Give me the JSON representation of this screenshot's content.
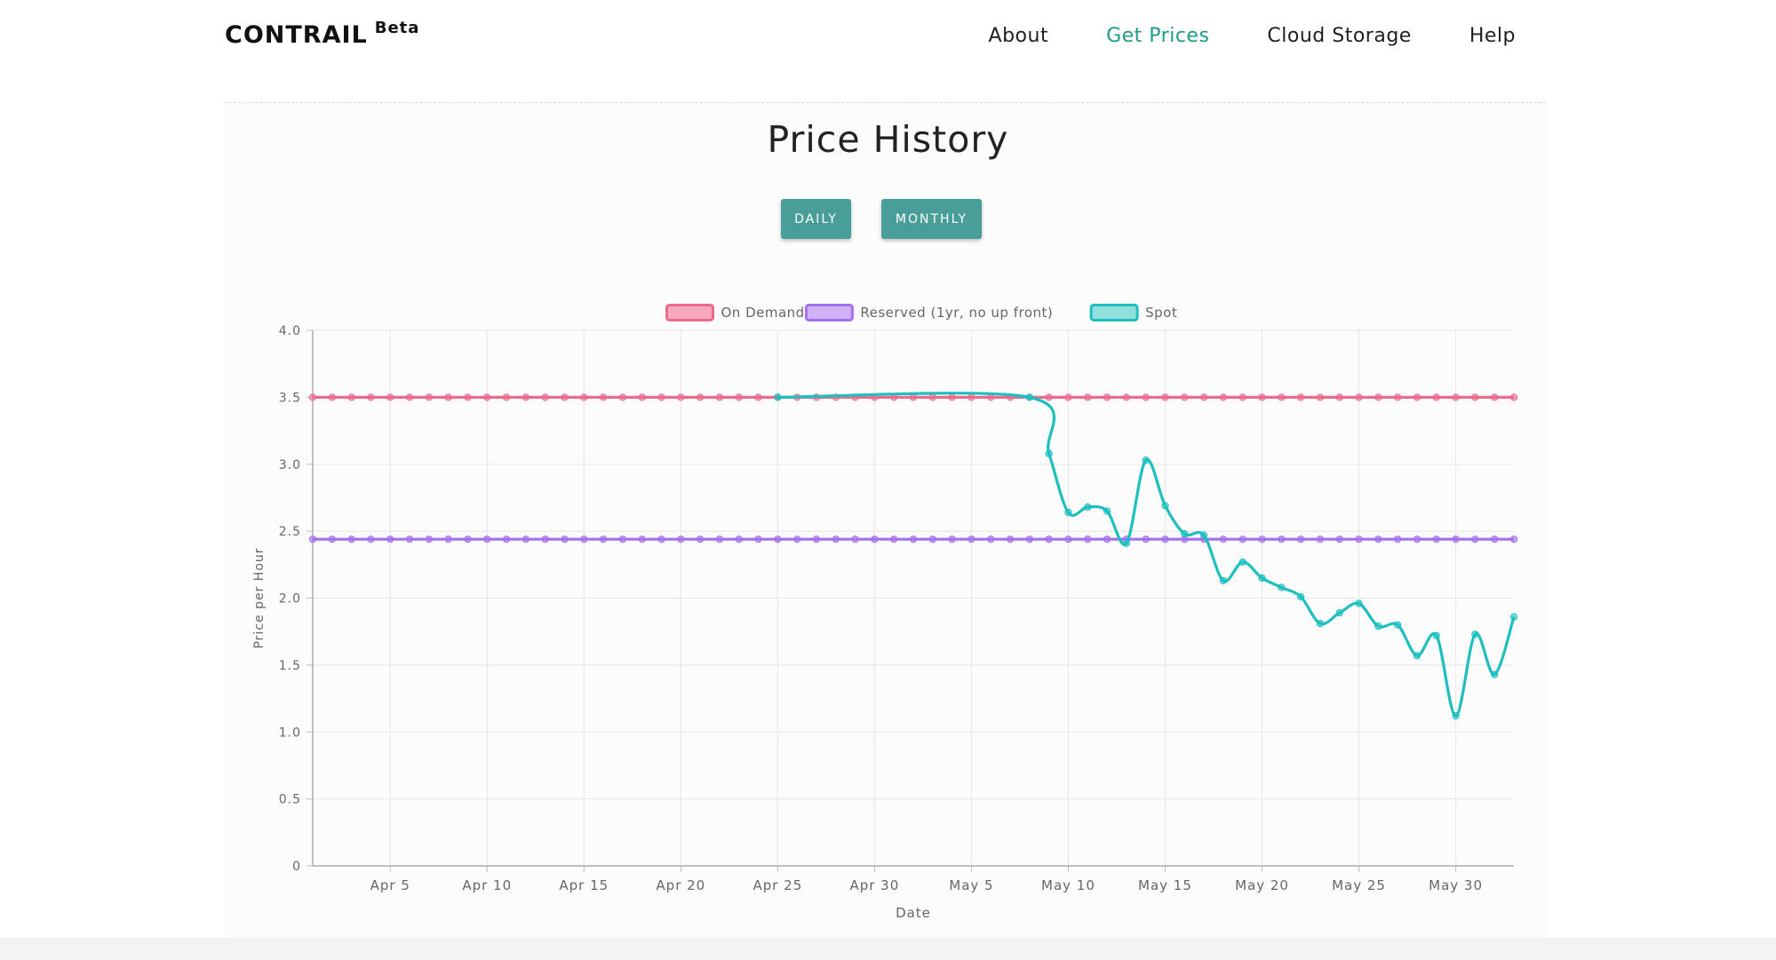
{
  "nav": {
    "brand": "CONTRAIL",
    "brand_sup": "Beta",
    "links": [
      "About",
      "Get Prices",
      "Cloud Storage",
      "Help"
    ]
  },
  "page": {
    "title": "Price History",
    "buttons": [
      "DAILY",
      "MONTHLY"
    ]
  },
  "colors": {
    "accent": "#1f9b89",
    "button": "#4a9e9a",
    "on_demand": "#ec6b8c",
    "reserved": "#a56ff0",
    "spot": "#1dbfbf"
  },
  "chart_data": {
    "type": "line",
    "xlabel": "Date",
    "ylabel": "Price per Hour",
    "ylim": [
      0,
      4.0
    ],
    "yticks": [
      "4.0",
      "3.5",
      "3.0",
      "2.5",
      "2.0",
      "1.5",
      "1.0",
      "0.5",
      "0"
    ],
    "x_start": "Apr 1",
    "x_end": "Jun 2",
    "xticks": [
      "Apr 5",
      "Apr 10",
      "Apr 15",
      "Apr 20",
      "Apr 25",
      "Apr 30",
      "May 5",
      "May 10",
      "May 15",
      "May 20",
      "May 25",
      "May 30"
    ],
    "grid": true,
    "legend_position": "top",
    "series": [
      {
        "name": "On Demand",
        "x": [
          "Apr 1",
          "Apr 2",
          "Apr 3",
          "Apr 4",
          "Apr 5",
          "Apr 6",
          "Apr 7",
          "Apr 8",
          "Apr 9",
          "Apr 10",
          "Apr 11",
          "Apr 12",
          "Apr 13",
          "Apr 14",
          "Apr 15",
          "Apr 16",
          "Apr 17",
          "Apr 18",
          "Apr 19",
          "Apr 20",
          "Apr 21",
          "Apr 22",
          "Apr 23",
          "Apr 24",
          "Apr 25",
          "Apr 26",
          "Apr 27",
          "Apr 28",
          "Apr 29",
          "Apr 30",
          "May 1",
          "May 2",
          "May 3",
          "May 4",
          "May 5",
          "May 6",
          "May 7",
          "May 8",
          "May 9",
          "May 10",
          "May 11",
          "May 12",
          "May 13",
          "May 14",
          "May 15",
          "May 16",
          "May 17",
          "May 18",
          "May 19",
          "May 20",
          "May 21",
          "May 22",
          "May 23",
          "May 24",
          "May 25",
          "May 26",
          "May 27",
          "May 28",
          "May 29",
          "May 30",
          "May 31",
          "Jun 1",
          "Jun 2"
        ],
        "values": [
          3.5,
          3.5,
          3.5,
          3.5,
          3.5,
          3.5,
          3.5,
          3.5,
          3.5,
          3.5,
          3.5,
          3.5,
          3.5,
          3.5,
          3.5,
          3.5,
          3.5,
          3.5,
          3.5,
          3.5,
          3.5,
          3.5,
          3.5,
          3.5,
          3.5,
          3.5,
          3.5,
          3.5,
          3.5,
          3.5,
          3.5,
          3.5,
          3.5,
          3.5,
          3.5,
          3.5,
          3.5,
          3.5,
          3.5,
          3.5,
          3.5,
          3.5,
          3.5,
          3.5,
          3.5,
          3.5,
          3.5,
          3.5,
          3.5,
          3.5,
          3.5,
          3.5,
          3.5,
          3.5,
          3.5,
          3.5,
          3.5,
          3.5,
          3.5,
          3.5,
          3.5,
          3.5,
          3.5
        ]
      },
      {
        "name": "Reserved (1yr, no up front)",
        "x": [
          "Apr 1",
          "Apr 2",
          "Apr 3",
          "Apr 4",
          "Apr 5",
          "Apr 6",
          "Apr 7",
          "Apr 8",
          "Apr 9",
          "Apr 10",
          "Apr 11",
          "Apr 12",
          "Apr 13",
          "Apr 14",
          "Apr 15",
          "Apr 16",
          "Apr 17",
          "Apr 18",
          "Apr 19",
          "Apr 20",
          "Apr 21",
          "Apr 22",
          "Apr 23",
          "Apr 24",
          "Apr 25",
          "Apr 26",
          "Apr 27",
          "Apr 28",
          "Apr 29",
          "Apr 30",
          "May 1",
          "May 2",
          "May 3",
          "May 4",
          "May 5",
          "May 6",
          "May 7",
          "May 8",
          "May 9",
          "May 10",
          "May 11",
          "May 12",
          "May 13",
          "May 14",
          "May 15",
          "May 16",
          "May 17",
          "May 18",
          "May 19",
          "May 20",
          "May 21",
          "May 22",
          "May 23",
          "May 24",
          "May 25",
          "May 26",
          "May 27",
          "May 28",
          "May 29",
          "May 30",
          "May 31",
          "Jun 1",
          "Jun 2"
        ],
        "values": [
          2.44,
          2.44,
          2.44,
          2.44,
          2.44,
          2.44,
          2.44,
          2.44,
          2.44,
          2.44,
          2.44,
          2.44,
          2.44,
          2.44,
          2.44,
          2.44,
          2.44,
          2.44,
          2.44,
          2.44,
          2.44,
          2.44,
          2.44,
          2.44,
          2.44,
          2.44,
          2.44,
          2.44,
          2.44,
          2.44,
          2.44,
          2.44,
          2.44,
          2.44,
          2.44,
          2.44,
          2.44,
          2.44,
          2.44,
          2.44,
          2.44,
          2.44,
          2.44,
          2.44,
          2.44,
          2.44,
          2.44,
          2.44,
          2.44,
          2.44,
          2.44,
          2.44,
          2.44,
          2.44,
          2.44,
          2.44,
          2.44,
          2.44,
          2.44,
          2.44,
          2.44,
          2.44,
          2.44
        ]
      },
      {
        "name": "Spot",
        "x": [
          "Apr 25",
          "May 8",
          "May 9",
          "May 10",
          "May 11",
          "May 12",
          "May 13",
          "May 14",
          "May 15",
          "May 16",
          "May 17",
          "May 18",
          "May 19",
          "May 20",
          "May 21",
          "May 22",
          "May 23",
          "May 24",
          "May 25",
          "May 26",
          "May 27",
          "May 28",
          "May 29",
          "May 30",
          "May 31",
          "Jun 1",
          "Jun 2"
        ],
        "values": [
          3.5,
          3.5,
          3.08,
          2.64,
          2.68,
          2.65,
          2.41,
          3.03,
          2.69,
          2.48,
          2.47,
          2.13,
          2.27,
          2.15,
          2.08,
          2.01,
          1.81,
          1.89,
          1.96,
          1.79,
          1.8,
          1.57,
          1.72,
          1.12,
          1.73,
          1.43,
          1.86
        ]
      }
    ]
  }
}
